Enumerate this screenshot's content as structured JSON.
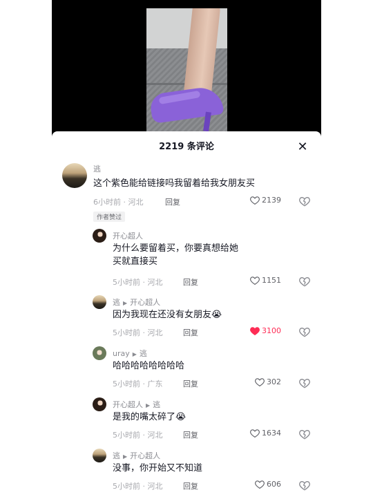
{
  "sheet": {
    "title": "2219 条评论"
  },
  "comments": [
    {
      "author": "逃",
      "reply_to": "",
      "text": "这个紫色能给链接吗我留着给我女朋友买",
      "time": "6小时前 · 河北",
      "reply_label": "回复",
      "likes": "2139",
      "liked": false,
      "badge": "作者赞过"
    },
    {
      "author": "开心超人",
      "reply_to": "",
      "text": "为什么要留着买，你要真想给她买就直接买",
      "time": "5小时前 · 河北",
      "reply_label": "回复",
      "likes": "1151",
      "liked": false
    },
    {
      "author": "逃",
      "reply_to": "开心超人",
      "text": "因为我现在还没有女朋友",
      "emoji": "😭",
      "time": "5小时前 · 河北",
      "reply_label": "回复",
      "likes": "3100",
      "liked": true
    },
    {
      "author": "uray",
      "reply_to": "逃",
      "text": "哈哈哈哈哈哈哈哈",
      "time": "5小时前 · 广东",
      "reply_label": "回复",
      "likes": "302",
      "liked": false
    },
    {
      "author": "开心超人",
      "reply_to": "逃",
      "text": "是我的嘴太碎了",
      "emoji": "😭",
      "time": "5小时前 · 河北",
      "reply_label": "回复",
      "likes": "1634",
      "liked": false
    },
    {
      "author": "逃",
      "reply_to": "开心超人",
      "text": "没事，你开始又不知道",
      "time": "5小时前 · 河北",
      "reply_label": "回复",
      "likes": "606",
      "liked": false
    }
  ],
  "colors": {
    "like_active": "#fe2c55",
    "meta": "#a8a9ae",
    "text": "#161823"
  },
  "icons": {
    "close": "close-icon",
    "heart": "heart-icon",
    "dislike": "broken-heart-icon",
    "reply_arrow": "triangle-right-icon"
  }
}
